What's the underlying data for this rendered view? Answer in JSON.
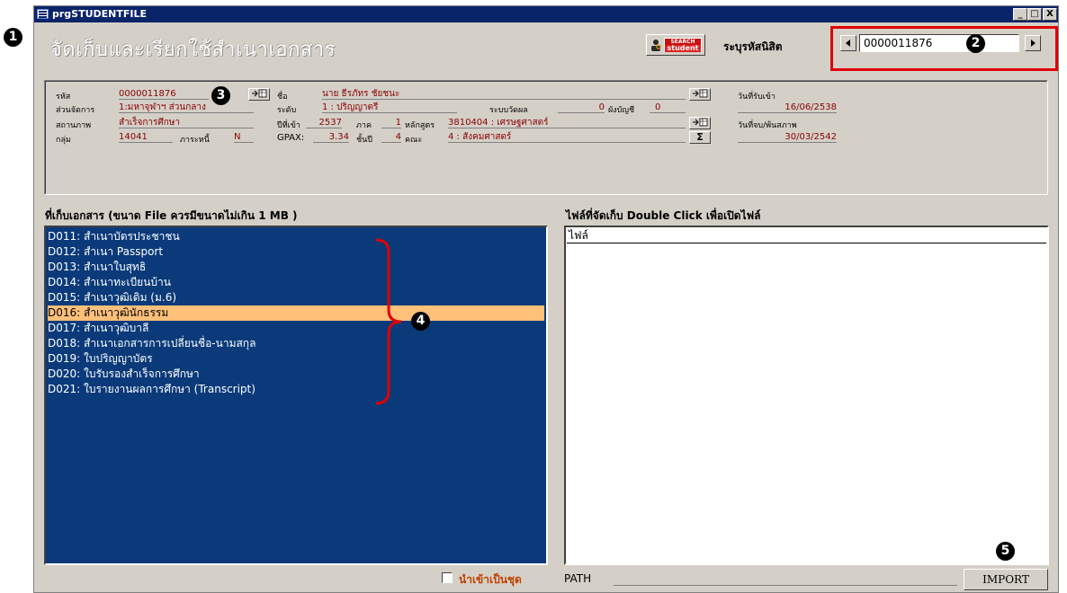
{
  "window": {
    "title": "prgSTUDENTFILE",
    "controls": [
      "_",
      "□",
      "X"
    ]
  },
  "header": {
    "title": "จัดเก็บและเรียกใช้สำเนาเอกสาร",
    "search_badge_top": "SEARCH",
    "search_badge_bottom": "student",
    "id_label": "ระบุรหัสนิสิต",
    "id_value": "0000011876"
  },
  "markers": [
    "1",
    "2",
    "3",
    "4",
    "5"
  ],
  "student": {
    "labels": {
      "code": "รหัส",
      "unit": "ส่วนจัดการ",
      "status": "สถานภาพ",
      "group": "กลุ่ม",
      "name": "ชื่อ",
      "level": "ระดับ",
      "entry_year": "ปีที่เข้า",
      "gpax": "GPAX:",
      "eval_system": "ระบบวัดผล",
      "semester": "ภาค",
      "program": "หลักสูตร",
      "class_year": "ชั้นปี",
      "faculty": "คณะ",
      "debt": "ภาระหนี้",
      "account": "ผังบัญชี",
      "admit_date": "วันที่รับเข้า",
      "grad_date": "วันที่จบ/พ้นสภาพ"
    },
    "values": {
      "code": "0000011876",
      "unit": "1:มหาจุฬาฯ ส่วนกลาง",
      "status": "สำเร็จการศึกษา",
      "group": "14041",
      "debt": "N",
      "name": "นาย ธีรภัทร ชัยชนะ",
      "level": "1 : ปริญญาตรี",
      "entry_year": "2537",
      "gpax": "3.34",
      "eval_count": "0",
      "semester": "1",
      "program": "3810404 : เศรษฐศาสตร์",
      "class_year": "4",
      "faculty": "4 : สังคมศาสตร์",
      "account": "0",
      "admit_date": "16/06/2538",
      "grad_date": "30/03/2542"
    },
    "sum_button": "Σ"
  },
  "documents": {
    "title": "ที่เก็บเอกสาร (ขนาด File ควรมีขนาดไม่เกิน 1 MB )",
    "items": [
      "D011: สำเนาบัตรประชาชน",
      "D012: สำเนา Passport",
      "D013: สำเนาใบสุทธิ",
      "D014: สำเนาทะเบียนบ้าน",
      "D015: สำเนาวุฒิเดิม (ม.6)",
      "D016: สำเนาวุฒินักธรรม",
      "D017: สำเนาวุฒิบาลี",
      "D018: สำเนาเอกสารการเปลี่ยนชื่อ-นามสกุล",
      "D019: ใบปริญญาบัตร",
      "D020: ใบรับรองสำเร็จการศึกษา",
      "D021: ใบรายงานผลการศึกษา (Transcript)"
    ],
    "selected_index": 5
  },
  "files": {
    "title": "ไฟล์ที่จัดเก็บ Double Click เพื่อเปิดไฟล์",
    "column_header": "ไฟล์"
  },
  "footer": {
    "import_as_set": "นำเข้าเป็นชุด",
    "path_label": "PATH",
    "import_button": "IMPORT"
  },
  "colors": {
    "list_bg": "#0a3a7a",
    "selected_bg": "#ffc07a",
    "value_text": "#8b0000",
    "highlight": "#e00000"
  }
}
